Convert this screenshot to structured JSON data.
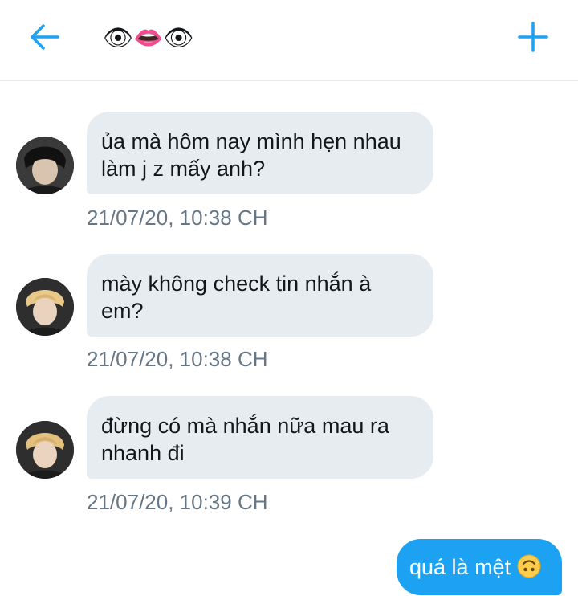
{
  "header": {
    "title_emojis": [
      "👁",
      "👄",
      "👁"
    ],
    "back_icon": "arrow-left-icon",
    "plus_icon": "plus-icon",
    "accent": "#1da1f2"
  },
  "messages": [
    {
      "text": "ủa mà hôm nay mình hẹn nhau làm j z mấy anh?",
      "timestamp": "21/07/20, 10:38 CH",
      "direction": "incoming"
    },
    {
      "text": "mày không check tin nhắn à em?",
      "timestamp": "21/07/20, 10:38 CH",
      "direction": "incoming"
    },
    {
      "text": "đừng có mà nhắn nữa mau ra nhanh đi",
      "timestamp": "21/07/20, 10:39 CH",
      "direction": "incoming"
    },
    {
      "text": "quá là mệt",
      "emoji": "upside-down-face-icon",
      "direction": "outgoing"
    }
  ],
  "colors": {
    "incoming_bubble": "#e6ecf0",
    "outgoing_bubble": "#1da1f2",
    "timestamp": "#657786"
  }
}
